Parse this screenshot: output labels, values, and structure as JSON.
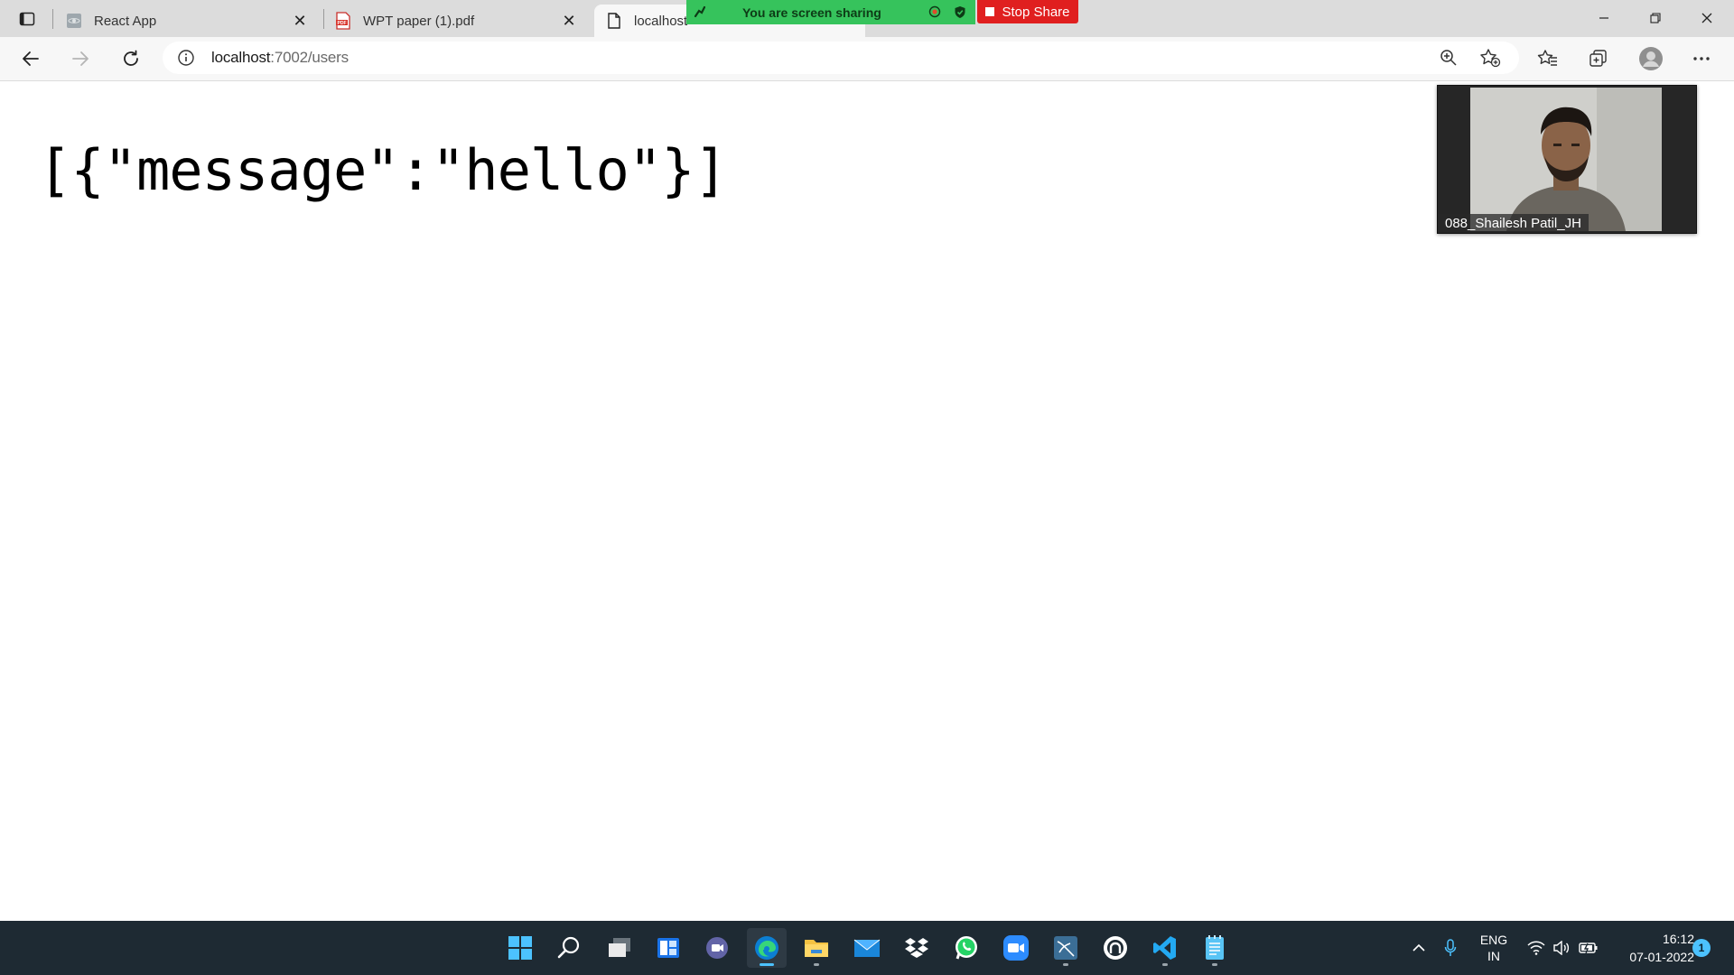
{
  "browser": {
    "tabs": [
      {
        "title": "React App"
      },
      {
        "title": "WPT paper (1).pdf"
      },
      {
        "title": "localhost"
      }
    ],
    "address": {
      "host": "localhost",
      "path": ":7002/users"
    }
  },
  "screen_share": {
    "banner_text": "You are screen sharing",
    "stop_label": "Stop Share"
  },
  "page": {
    "json_text": "[{\"message\":\"hello\"}]"
  },
  "video": {
    "participant_name": "088_Shailesh Patil_JH"
  },
  "taskbar": {
    "language_line1": "ENG",
    "language_line2": "IN",
    "time": "16:12",
    "date": "07-01-2022",
    "notification_count": "1"
  }
}
